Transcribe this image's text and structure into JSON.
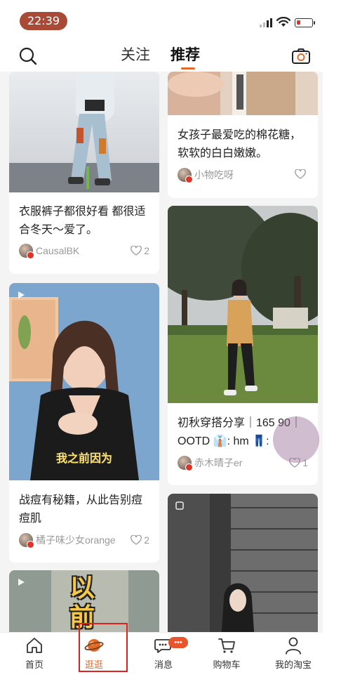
{
  "status_bar": {
    "time": "22:39"
  },
  "header": {
    "tab_follow": "关注",
    "tab_recommend": "推荐",
    "active_tab": "推荐"
  },
  "feed": {
    "left_column": [
      {
        "title": "衣服裤子都很好看 都很适合冬天～爱了。",
        "author": "CausalBK",
        "likes": "2"
      },
      {
        "title": "战痘有秘籍，从此告别痘痘肌",
        "author": "橘子味少女orange",
        "likes": "2",
        "video": true,
        "caption": "我之前因为"
      },
      {
        "title": "",
        "author": "",
        "likes": "",
        "video": true,
        "caption": "以前"
      }
    ],
    "right_column": [
      {
        "title": "女孩子最爱吃的棉花糖，软软的白白嫩嫩。",
        "author": "小物吃呀",
        "likes": ""
      },
      {
        "title": "初秋穿搭分享｜165 90｜OOTD 👔: hm 👖:",
        "author": "赤木晴子er",
        "likes": "1"
      },
      {
        "title": "",
        "author": "",
        "likes": "",
        "video": true
      }
    ]
  },
  "bottom_nav": {
    "items": [
      {
        "label": "首页",
        "icon": "home-icon"
      },
      {
        "label": "逛逛",
        "icon": "planet-icon",
        "active": true
      },
      {
        "label": "消息",
        "icon": "message-icon",
        "badge": "•••"
      },
      {
        "label": "购物车",
        "icon": "cart-icon"
      },
      {
        "label": "我的淘宝",
        "icon": "user-icon"
      }
    ]
  },
  "colors": {
    "accent": "#e26b2a",
    "time_pill": "#a94a36",
    "badge": "#e8552c",
    "highlight": "#e0201c"
  }
}
